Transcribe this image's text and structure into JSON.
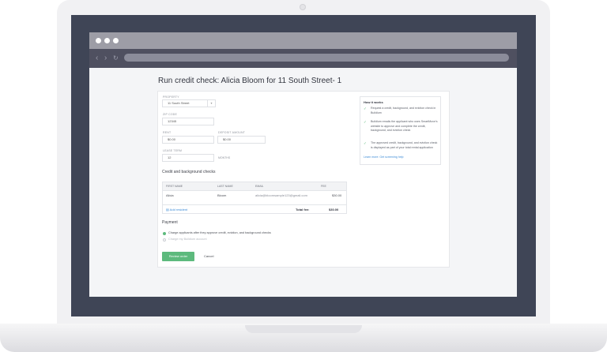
{
  "page": {
    "title": "Run credit check: Alicia Bloom for 11 South Street- 1"
  },
  "browser": {
    "back_icon": "chevron-left-icon",
    "forward_icon": "chevron-right-icon",
    "reload_icon": "refresh-icon"
  },
  "form": {
    "property": {
      "label": "PROPERTY",
      "value": "11 South Street"
    },
    "zip": {
      "label": "ZIP CODE",
      "value": "12345"
    },
    "rent": {
      "label": "RENT",
      "value": "$0.00"
    },
    "deposit": {
      "label": "DEPOSIT AMOUNT",
      "value": "$0.00"
    },
    "lease_term": {
      "label": "LEASE TERM",
      "value": "12",
      "unit": "MONTHS"
    }
  },
  "checks": {
    "title": "Credit and background checks",
    "columns": [
      "FIRST NAME",
      "LAST NAME",
      "EMAIL",
      "FEE"
    ],
    "rows": [
      {
        "first": "Alicia",
        "last": "Bloom",
        "email": "alicia@bloomsample123@gmail.com",
        "fee": "$30.00"
      }
    ],
    "add_label": "Add resident",
    "total_label": "Total fee:",
    "total_value": "$30.00"
  },
  "payment": {
    "title": "Payment",
    "option1": "Charge applicants after they approve credit, eviction, and background checks",
    "option2": "Charge my Buildium account"
  },
  "actions": {
    "review": "Review order",
    "cancel": "Cancel"
  },
  "help": {
    "title": "How it works",
    "steps": [
      "Request a credit, background, and eviction check in Buildium",
      "Buildium emails the applicant who uses SmartMove's website to approve and complete the credit, background, and eviction check",
      "The approved credit, background, and eviction check is displayed as part of your total rental application"
    ],
    "link": "Learn more: Get screening help"
  },
  "colors": {
    "accent": "#5dba7d",
    "link": "#3c8bd6",
    "screen_bezel": "#3f4556"
  }
}
